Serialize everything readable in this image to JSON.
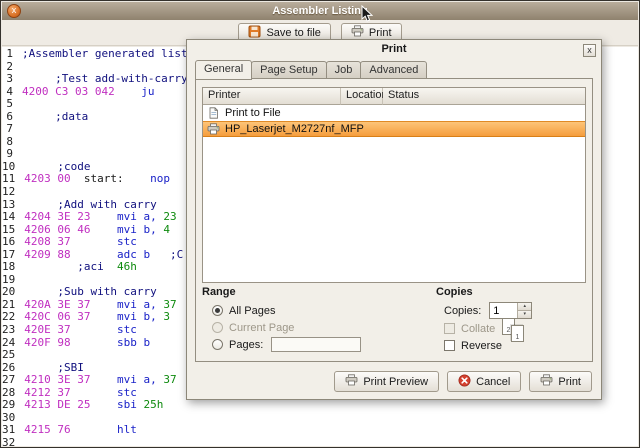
{
  "window": {
    "title": "Assembler Listing",
    "close_glyph": "x",
    "toolbar": {
      "save": "Save to file",
      "print": "Print"
    }
  },
  "listing": {
    "colors": {
      "addr": "#C02FC0",
      "mn": "#1A22C8",
      "op": "#0E8A0E",
      "cm": "#10107E",
      "lbl": "#1a1a1a"
    },
    "lines": [
      [
        {
          "c": "cm",
          "t": ";Assembler generated list"
        }
      ],
      [],
      [
        {
          "c": "cm",
          "t": "     ;Test add-with-carry"
        }
      ],
      [
        {
          "c": "addr",
          "t": "4200 C3 03 042"
        },
        {
          "c": "mn",
          "t": "    ju"
        }
      ],
      [],
      [
        {
          "c": "cm",
          "t": "     ;data"
        }
      ],
      [],
      [],
      [],
      [
        {
          "c": "cm",
          "t": "     ;code"
        }
      ],
      [
        {
          "c": "addr",
          "t": "4203 00"
        },
        {
          "c": "lbl",
          "t": "  start:"
        },
        {
          "c": "mn",
          "t": "    nop"
        }
      ],
      [],
      [
        {
          "c": "cm",
          "t": "     ;Add with carry"
        }
      ],
      [
        {
          "c": "addr",
          "t": "4204 3E 23"
        },
        {
          "c": "mn",
          "t": "    mvi a,"
        },
        {
          "c": "op",
          "t": " 23"
        }
      ],
      [
        {
          "c": "addr",
          "t": "4206 06 46"
        },
        {
          "c": "mn",
          "t": "    mvi b,"
        },
        {
          "c": "op",
          "t": " 4"
        }
      ],
      [
        {
          "c": "addr",
          "t": "4208 37"
        },
        {
          "c": "mn",
          "t": "       stc"
        }
      ],
      [
        {
          "c": "addr",
          "t": "4209 88"
        },
        {
          "c": "mn",
          "t": "       adc b"
        },
        {
          "c": "cm",
          "t": "   ;C"
        }
      ],
      [
        {
          "c": "cm",
          "t": "        ;aci  "
        },
        {
          "c": "op",
          "t": "46h"
        }
      ],
      [],
      [
        {
          "c": "cm",
          "t": "     ;Sub with carry"
        }
      ],
      [
        {
          "c": "addr",
          "t": "420A 3E 37"
        },
        {
          "c": "mn",
          "t": "    mvi a,"
        },
        {
          "c": "op",
          "t": " 37"
        }
      ],
      [
        {
          "c": "addr",
          "t": "420C 06 37"
        },
        {
          "c": "mn",
          "t": "    mvi b,"
        },
        {
          "c": "op",
          "t": " 3"
        }
      ],
      [
        {
          "c": "addr",
          "t": "420E 37"
        },
        {
          "c": "mn",
          "t": "       stc"
        }
      ],
      [
        {
          "c": "addr",
          "t": "420F 98"
        },
        {
          "c": "mn",
          "t": "       sbb b"
        }
      ],
      [],
      [
        {
          "c": "cm",
          "t": "     ;SBI"
        }
      ],
      [
        {
          "c": "addr",
          "t": "4210 3E 37"
        },
        {
          "c": "mn",
          "t": "    mvi a,"
        },
        {
          "c": "op",
          "t": " 37"
        }
      ],
      [
        {
          "c": "addr",
          "t": "4212 37"
        },
        {
          "c": "mn",
          "t": "       stc"
        }
      ],
      [
        {
          "c": "addr",
          "t": "4213 DE 25"
        },
        {
          "c": "mn",
          "t": "    sbi"
        },
        {
          "c": "op",
          "t": " 25h"
        }
      ],
      [],
      [
        {
          "c": "addr",
          "t": "4215 76"
        },
        {
          "c": "mn",
          "t": "       hlt"
        }
      ],
      []
    ]
  },
  "print_dialog": {
    "title": "Print",
    "close_glyph": "x",
    "tabs": [
      {
        "label": "General",
        "active": true
      },
      {
        "label": "Page Setup",
        "active": false
      },
      {
        "label": "Job",
        "active": false
      },
      {
        "label": "Advanced",
        "active": false
      }
    ],
    "printers": {
      "columns": [
        "Printer",
        "Location",
        "Status"
      ],
      "rows": [
        {
          "name": "Print to File",
          "location": "",
          "status": "",
          "selected": false,
          "icon": "print-to-file-icon"
        },
        {
          "name": "HP_Laserjet_M2727nf_MFP",
          "location": "",
          "status": "",
          "selected": true,
          "icon": "printer-icon"
        }
      ],
      "selection_color": "#F59D3D"
    },
    "range": {
      "title": "Range",
      "options": [
        {
          "label": "All Pages",
          "state": "selected",
          "has_entry": false
        },
        {
          "label": "Current Page",
          "state": "disabled",
          "has_entry": false
        },
        {
          "label": "Pages:",
          "state": "normal",
          "has_entry": true,
          "entry_value": ""
        }
      ]
    },
    "copies": {
      "title": "Copies",
      "label": "Copies:",
      "value": "1",
      "collate": "Collate",
      "collate_disabled": true,
      "reverse": "Reverse",
      "collate_pages": [
        "2",
        "1"
      ]
    },
    "actions": {
      "preview": "Print Preview",
      "cancel": "Cancel",
      "print": "Print"
    }
  }
}
